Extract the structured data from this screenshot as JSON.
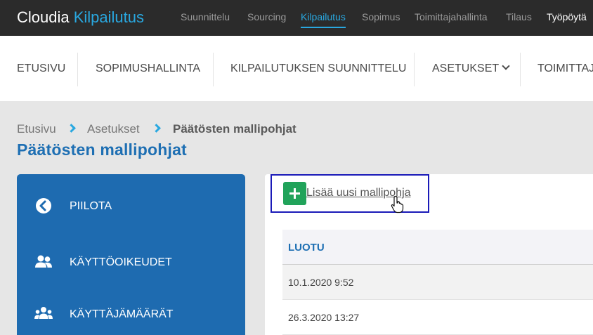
{
  "app": {
    "brand_main": "Cloudia",
    "brand_accent": "Kilpailutus"
  },
  "topnav": {
    "items": [
      {
        "label": "Suunnittelu"
      },
      {
        "label": "Sourcing"
      },
      {
        "label": "Kilpailutus",
        "active": true
      },
      {
        "label": "Sopimus"
      },
      {
        "label": "Toimittajahallinta"
      },
      {
        "label": "Tilaus"
      },
      {
        "label": "Työpöytä"
      }
    ]
  },
  "subnav": {
    "items": [
      {
        "label": "ETUSIVU"
      },
      {
        "label": "SOPIMUSHALLINTA"
      },
      {
        "label": "KILPAILUTUKSEN SUUNNITTELU"
      },
      {
        "label": "ASETUKSET",
        "icon": "chevron-down-icon"
      },
      {
        "label": "TOIMITTAJA"
      }
    ]
  },
  "breadcrumb": {
    "items": [
      "Etusivu",
      "Asetukset",
      "Päätösten mallipohjat"
    ]
  },
  "page": {
    "title": "Päätösten mallipohjat"
  },
  "sidebar": {
    "items": [
      {
        "label": "PIILOTA",
        "icon": "chevron-left-circle-icon"
      },
      {
        "label": "KÄYTTÖOIKEUDET",
        "icon": "users-icon"
      },
      {
        "label": "KÄYTTÄJÄMÄÄRÄT",
        "icon": "user-group-icon"
      }
    ]
  },
  "content": {
    "add_label": "Lisää uusi mallipohja",
    "add_icon": "plus-icon",
    "table": {
      "columns": [
        "LUOTU"
      ],
      "rows": [
        [
          "10.1.2020 9:52"
        ],
        [
          "26.3.2020 13:27"
        ]
      ]
    }
  },
  "colors": {
    "accent": "#29a8e0",
    "topbar": "#2b2b2b",
    "sidebar": "#1e6bb0",
    "title": "#1e6fb3",
    "add_button": "#21a35a"
  }
}
